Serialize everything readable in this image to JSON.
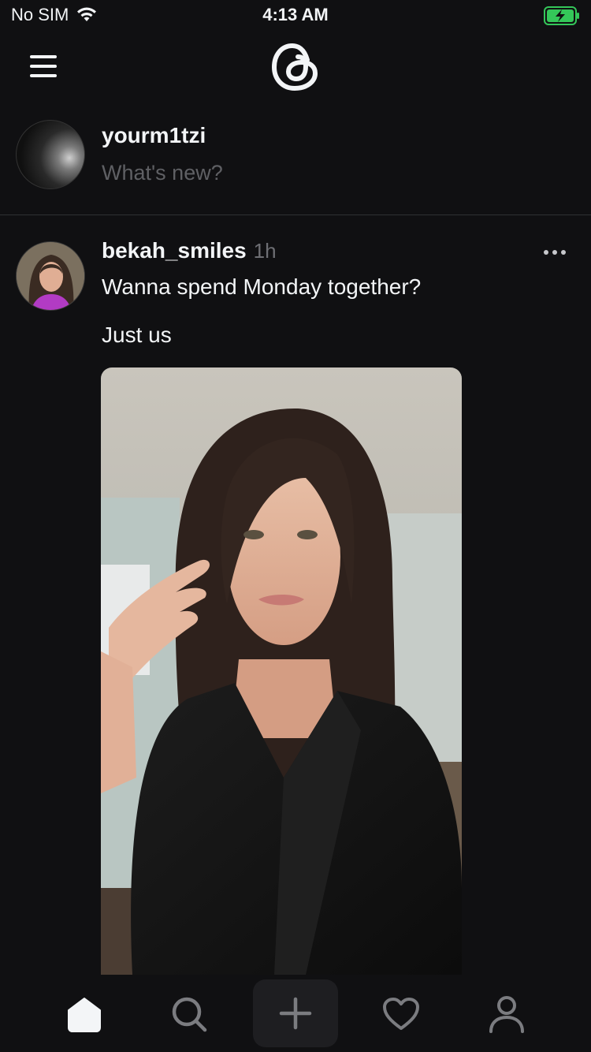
{
  "status_bar": {
    "carrier": "No SIM",
    "time": "4:13 AM",
    "battery_color": "#34c759"
  },
  "header": {
    "menu_icon": "hamburger-menu-icon",
    "logo": "threads-logo-icon"
  },
  "composer": {
    "username": "yourm1tzi",
    "placeholder": "What's new?"
  },
  "post": {
    "username": "bekah_smiles",
    "time_ago": "1h",
    "lines": [
      "Wanna spend Monday together?",
      "Just us"
    ],
    "more_icon": "more-options-icon"
  },
  "tab_bar": {
    "items": [
      {
        "name": "home",
        "icon": "home-icon",
        "active": true
      },
      {
        "name": "search",
        "icon": "search-icon",
        "active": false
      },
      {
        "name": "compose",
        "icon": "plus-icon",
        "active": false
      },
      {
        "name": "activity",
        "icon": "heart-icon",
        "active": false
      },
      {
        "name": "profile",
        "icon": "person-icon",
        "active": false
      }
    ]
  },
  "colors": {
    "background": "#101012",
    "text": "#f3f5f7",
    "muted_text": "#5f6064",
    "divider": "#2f3033"
  }
}
